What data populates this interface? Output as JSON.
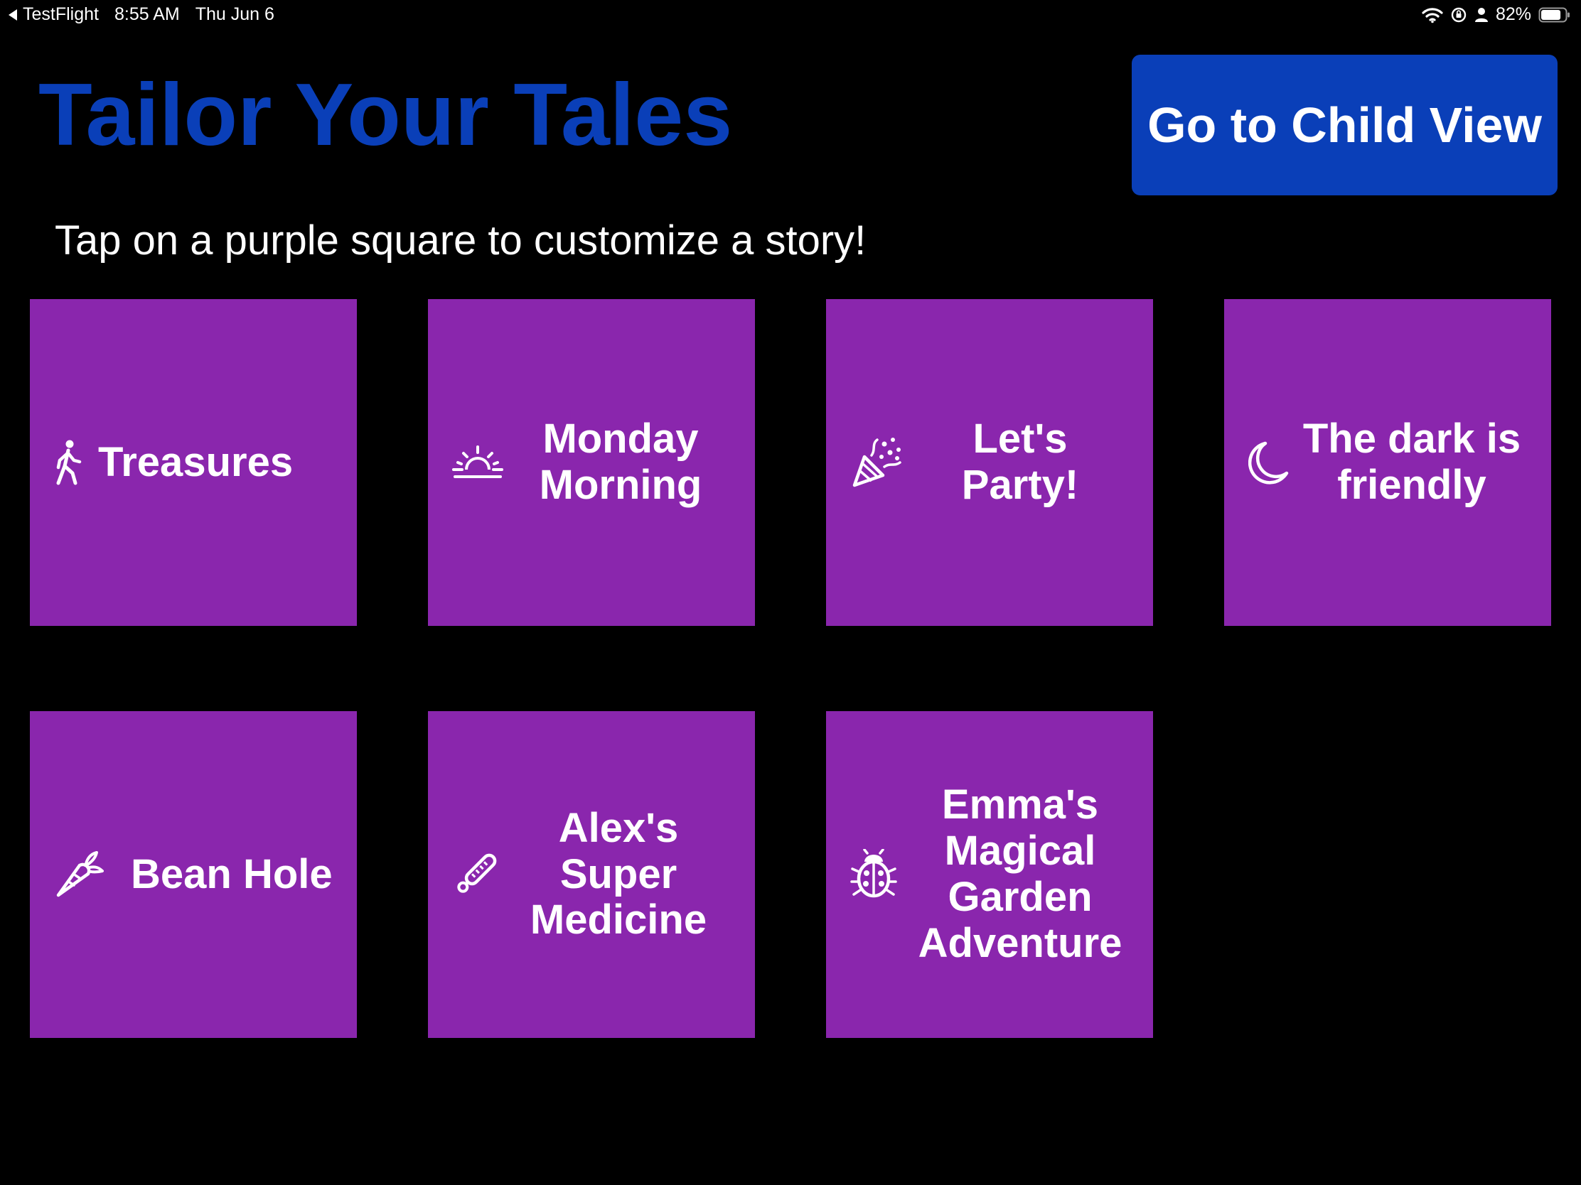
{
  "status_bar": {
    "back_app": "TestFlight",
    "time": "8:55 AM",
    "date": "Thu Jun 6",
    "battery_percent": "82%",
    "battery_level": 0.82,
    "icons": [
      "wifi-icon",
      "orientation-lock-icon",
      "person-icon",
      "battery-icon"
    ]
  },
  "header": {
    "title": "Tailor Your Tales",
    "title_color": "#0a3fb8",
    "child_view_button": "Go to Child View",
    "button_color": "#0a3fb8"
  },
  "instructions": "Tap on a purple square to customize a story!",
  "tile_color": "#8a26ad",
  "stories": [
    {
      "label": "Treasures",
      "icon": "walking-person-icon"
    },
    {
      "label": "Monday Morning",
      "icon": "sunrise-icon"
    },
    {
      "label": "Let's Party!",
      "icon": "party-popper-icon"
    },
    {
      "label": "The dark is friendly",
      "icon": "moon-icon"
    },
    {
      "label": "Bean Hole",
      "icon": "carrot-icon"
    },
    {
      "label": "Alex's Super Medicine",
      "icon": "thermometer-icon"
    },
    {
      "label": "Emma's Magical Garden Adventure",
      "icon": "ladybug-icon"
    }
  ]
}
